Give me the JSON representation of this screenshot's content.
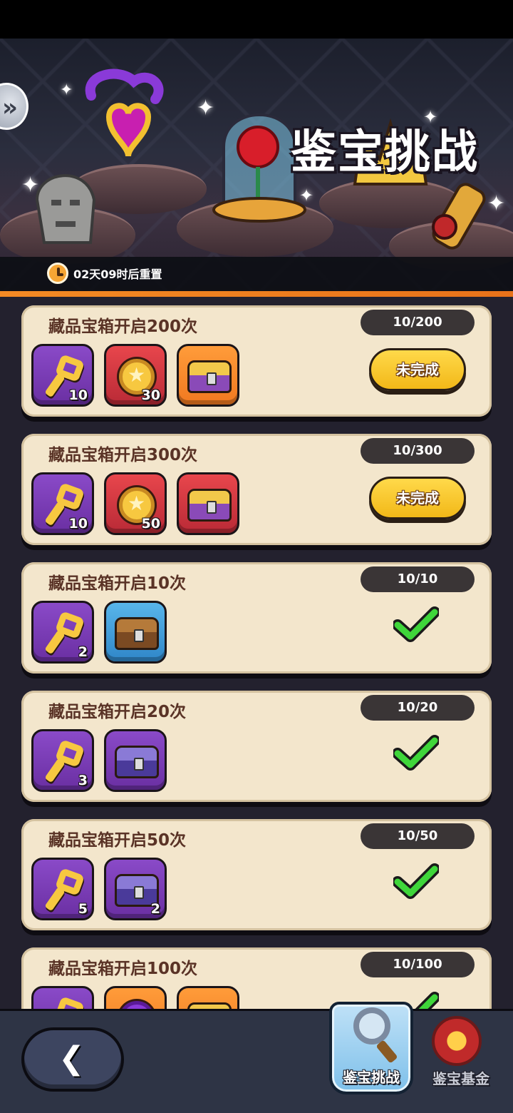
{
  "banner": {
    "title": "鉴宝挑战",
    "timer_text": "02天09时后重置",
    "icons": [
      "back-tab-icon",
      "amulet-icon",
      "stone-head-icon",
      "rose-dome-icon",
      "crown-icon",
      "scroll-icon",
      "clock-icon"
    ]
  },
  "tasks": [
    {
      "title": "藏品宝箱开启200次",
      "progress": "10/200",
      "status": "未完成",
      "completed": false,
      "rewards": [
        {
          "icon": "key-icon",
          "bg": "purple",
          "count": "10"
        },
        {
          "icon": "medal-icon",
          "bg": "red",
          "count": "30"
        },
        {
          "icon": "mystery-chest-icon",
          "bg": "orange",
          "count": ""
        }
      ]
    },
    {
      "title": "藏品宝箱开启300次",
      "progress": "10/300",
      "status": "未完成",
      "completed": false,
      "rewards": [
        {
          "icon": "key-icon",
          "bg": "purple",
          "count": "10"
        },
        {
          "icon": "medal-icon",
          "bg": "red",
          "count": "50"
        },
        {
          "icon": "mystery-chest-icon",
          "bg": "red",
          "count": ""
        }
      ]
    },
    {
      "title": "藏品宝箱开启10次",
      "progress": "10/10",
      "completed": true,
      "rewards": [
        {
          "icon": "key-icon",
          "bg": "purple",
          "count": "2"
        },
        {
          "icon": "wooden-chest-icon",
          "bg": "blue",
          "count": ""
        }
      ]
    },
    {
      "title": "藏品宝箱开启20次",
      "progress": "10/20",
      "completed": true,
      "rewards": [
        {
          "icon": "key-icon",
          "bg": "purple",
          "count": "3"
        },
        {
          "icon": "violet-chest-icon",
          "bg": "purple",
          "count": ""
        }
      ]
    },
    {
      "title": "藏品宝箱开启50次",
      "progress": "10/50",
      "completed": true,
      "rewards": [
        {
          "icon": "key-icon",
          "bg": "purple",
          "count": "5"
        },
        {
          "icon": "violet-chest-icon",
          "bg": "purple",
          "count": "2"
        }
      ]
    },
    {
      "title": "藏品宝箱开启100次",
      "progress": "10/100",
      "completed": true,
      "rewards": [
        {
          "icon": "key-icon",
          "bg": "purple",
          "count": ""
        },
        {
          "icon": "pouch-icon",
          "bg": "orange",
          "count": ""
        },
        {
          "icon": "mystery-chest-icon",
          "bg": "orange",
          "count": ""
        }
      ]
    }
  ],
  "bottom_nav": {
    "back_icon": "back-arrow-icon",
    "tabs": [
      {
        "label": "鉴宝挑战",
        "icon": "magnifier-icon",
        "active": true
      },
      {
        "label": "鉴宝基金",
        "icon": "fund-coin-icon",
        "active": false
      }
    ]
  },
  "colors": {
    "accent_orange": "#f48a24",
    "card_bg": "#f3e6cc",
    "title_brown": "#5a3326",
    "check_green": "#3fd63a",
    "pill_dark": "#3a3536"
  }
}
